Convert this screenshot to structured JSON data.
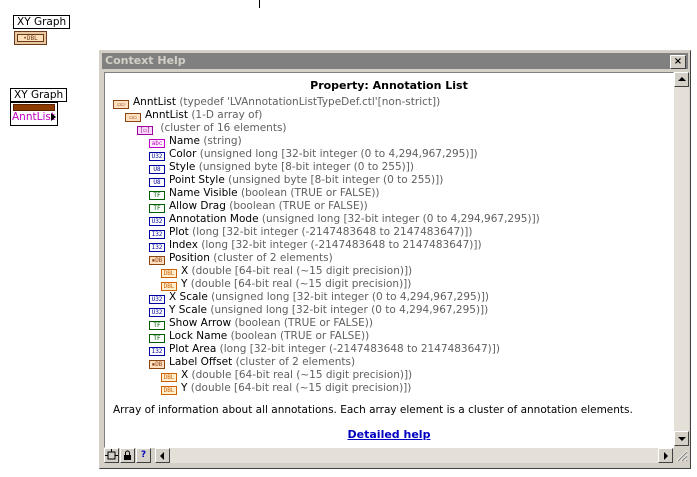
{
  "diagram": {
    "graph_terminal_label": "XY Graph",
    "property_node_label": "XY Graph",
    "property_node_item": "AnntList",
    "terminal_caption": "•DBL"
  },
  "window": {
    "title": "Context Help",
    "close_symbol": "×",
    "property_title": "Property:  Annotation List",
    "description": "Array of information about all annotations. Each array element is a cluster of annotation elements.",
    "detailed_help": "Detailed help",
    "toolbar": {
      "help_symbol": "?"
    }
  },
  "tree": [
    {
      "indent": 0,
      "icon": "cluster",
      "code": "▭▭",
      "name": "AnntList",
      "type": "(typedef 'LVAnnotationListTypeDef.ctl'[non-strict])"
    },
    {
      "indent": 1,
      "icon": "cluster",
      "code": "▭▭",
      "name": "AnntList",
      "type": "(1-D array of)"
    },
    {
      "indent": 2,
      "icon": "array",
      "code": "[▭]",
      "name": "",
      "type": "(cluster of 16 elements)"
    },
    {
      "indent": 3,
      "icon": "string",
      "code": "abc",
      "name": "Name",
      "type": "(string)"
    },
    {
      "indent": 3,
      "icon": "u32",
      "code": "U32",
      "name": "Color",
      "type": "(unsigned long [32-bit integer (0 to 4,294,967,295)])"
    },
    {
      "indent": 3,
      "icon": "u32",
      "code": "U8",
      "name": "Style",
      "type": "(unsigned byte [8-bit integer (0 to 255)])"
    },
    {
      "indent": 3,
      "icon": "u32",
      "code": "U8",
      "name": "Point Style",
      "type": "(unsigned byte [8-bit integer (0 to 255)])"
    },
    {
      "indent": 3,
      "icon": "bool",
      "code": "TF",
      "name": "Name Visible",
      "type": "(boolean (TRUE or FALSE))"
    },
    {
      "indent": 3,
      "icon": "bool",
      "code": "TF",
      "name": "Allow Drag",
      "type": "(boolean (TRUE or FALSE))"
    },
    {
      "indent": 3,
      "icon": "u32",
      "code": "U32",
      "name": "Annotation Mode",
      "type": "(unsigned long [32-bit integer (0 to 4,294,967,295)])"
    },
    {
      "indent": 3,
      "icon": "i32",
      "code": "I32",
      "name": "Plot",
      "type": "(long [32-bit integer (-2147483648 to 2147483647)])"
    },
    {
      "indent": 3,
      "icon": "i32",
      "code": "I32",
      "name": "Index",
      "type": "(long [32-bit integer (-2147483648 to 2147483647)])"
    },
    {
      "indent": 3,
      "icon": "cluster",
      "code": "▪DB",
      "name": "Position",
      "type": "(cluster of 2 elements)"
    },
    {
      "indent": 4,
      "icon": "dbl",
      "code": "DBL",
      "name": "X",
      "type": "(double [64-bit real (~15 digit precision)])"
    },
    {
      "indent": 4,
      "icon": "dbl",
      "code": "DBL",
      "name": "Y",
      "type": "(double [64-bit real (~15 digit precision)])"
    },
    {
      "indent": 3,
      "icon": "u32",
      "code": "U32",
      "name": "X Scale",
      "type": "(unsigned long [32-bit integer (0 to 4,294,967,295)])"
    },
    {
      "indent": 3,
      "icon": "u32",
      "code": "U32",
      "name": "Y Scale",
      "type": "(unsigned long [32-bit integer (0 to 4,294,967,295)])"
    },
    {
      "indent": 3,
      "icon": "bool",
      "code": "TF",
      "name": "Show Arrow",
      "type": "(boolean (TRUE or FALSE))"
    },
    {
      "indent": 3,
      "icon": "bool",
      "code": "TF",
      "name": "Lock Name",
      "type": "(boolean (TRUE or FALSE))"
    },
    {
      "indent": 3,
      "icon": "i32",
      "code": "I32",
      "name": "Plot Area",
      "type": "(long [32-bit integer (-2147483648 to 2147483647)])"
    },
    {
      "indent": 3,
      "icon": "cluster",
      "code": "▪DB",
      "name": "Label Offset",
      "type": "(cluster of 2 elements)"
    },
    {
      "indent": 4,
      "icon": "dbl",
      "code": "DBL",
      "name": "X",
      "type": "(double [64-bit real (~15 digit precision)])"
    },
    {
      "indent": 4,
      "icon": "dbl",
      "code": "DBL",
      "name": "Y",
      "type": "(double [64-bit real (~15 digit precision)])"
    }
  ]
}
